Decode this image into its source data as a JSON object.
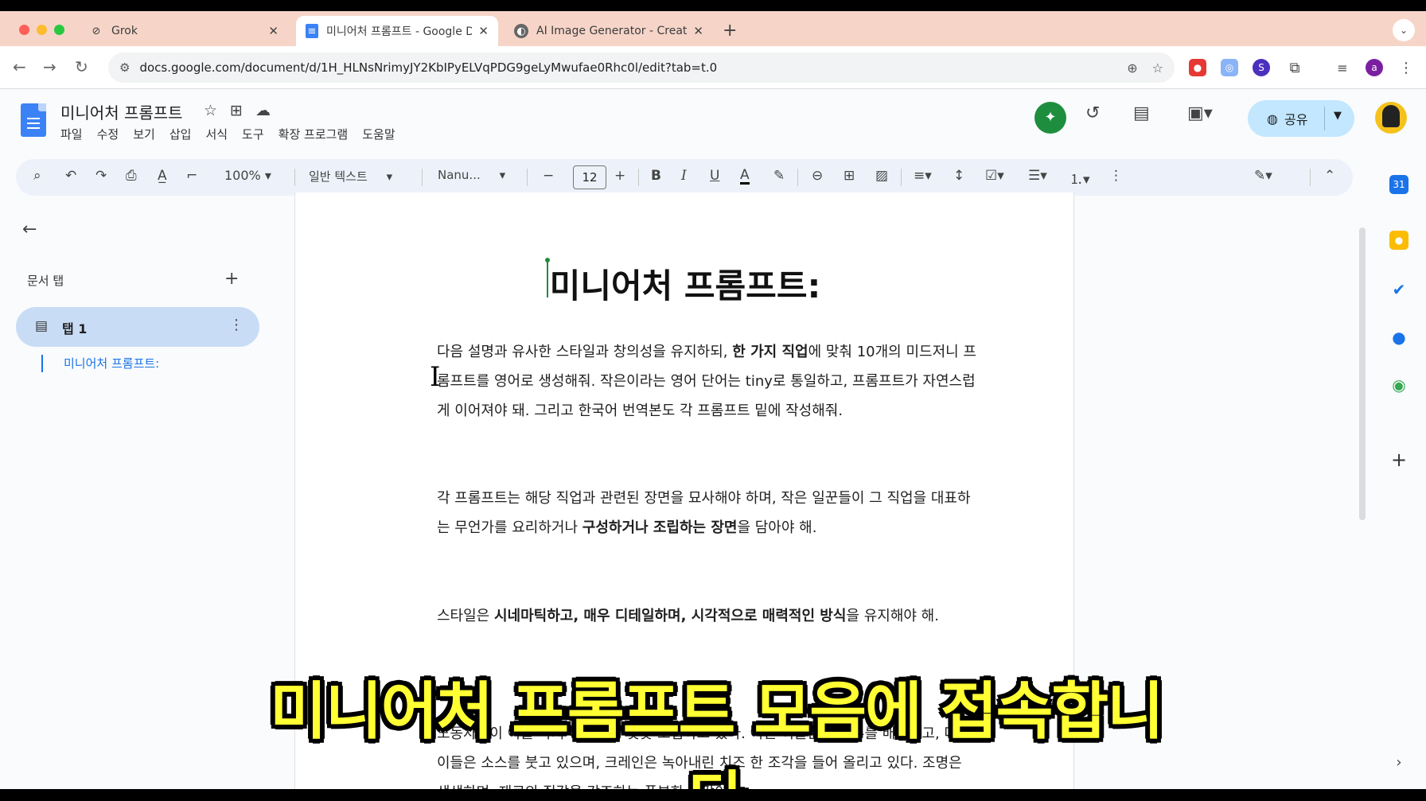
{
  "browser": {
    "tabs": [
      {
        "title": "Grok",
        "active": false
      },
      {
        "title": "미니어처 프롬프트 - Google Doc",
        "active": true
      },
      {
        "title": "AI Image Generator - Create",
        "active": false
      }
    ],
    "url": "docs.google.com/document/d/1H_HLNsNrimyJY2KbIPyELVqPDG9geLyMwufae0Rhc0l/edit?tab=t.0"
  },
  "docs": {
    "title": "미니어처 프롬프트",
    "menu": [
      "파일",
      "수정",
      "보기",
      "삽입",
      "서식",
      "도구",
      "확장 프로그램",
      "도움말"
    ],
    "share_label": "공유",
    "toolbar": {
      "zoom": "100%",
      "style": "일반 텍스트",
      "font": "Nanu...",
      "font_size": "12"
    },
    "sidebar": {
      "section_title": "문서 탭",
      "tab_label": "탭 1",
      "outline_item": "미니어처 프롬프트:"
    },
    "page": {
      "heading": "미니어처 프롬프트:",
      "p1": [
        "다음 설명과 유사한 스타일과 창의성을 유지하되, ",
        "한 가지 직업",
        "에 맞춰 10개의 미드저니 프롬프트를 영어로 생성해줘. 작은이라는 영어 단어는 tiny로 통일하고, 프롬프트가 자연스럽게 이어져야 돼. 그리고 한국어 번역본도 각 프롬프트 밑에 작성해줘."
      ],
      "p2": [
        "각 프롬프트는 해당 직업과 관련된 장면을 묘사해야 하며, 작은 일꾼들이 그 직업을 대표하는 무언가를 요리하거나 ",
        "구성하거나 조립하는 장면",
        "을 담아야 해."
      ],
      "p3": [
        "스타일은 ",
        "시네마틱하고, 매우 디테일하며, 시각적으로 매력적인 방식",
        "을 유지해야 해."
      ],
      "p4_visible": "노동자들이 이를 마치 마천루를 짓듯 조립하고 있다. 어떤 이들은 양상추를 배치하고, 다른 이들은 소스를 붓고 있으며, 크레인은 녹아내린 치즈 한 조각을 들어 올리고 있다. 조명은 생생하며, 재료의 질감을 강조하는 풍부한 색감이"
    }
  },
  "overlay": {
    "subtitle": "미니어처 프롬프트 모음에 접속합니다"
  }
}
